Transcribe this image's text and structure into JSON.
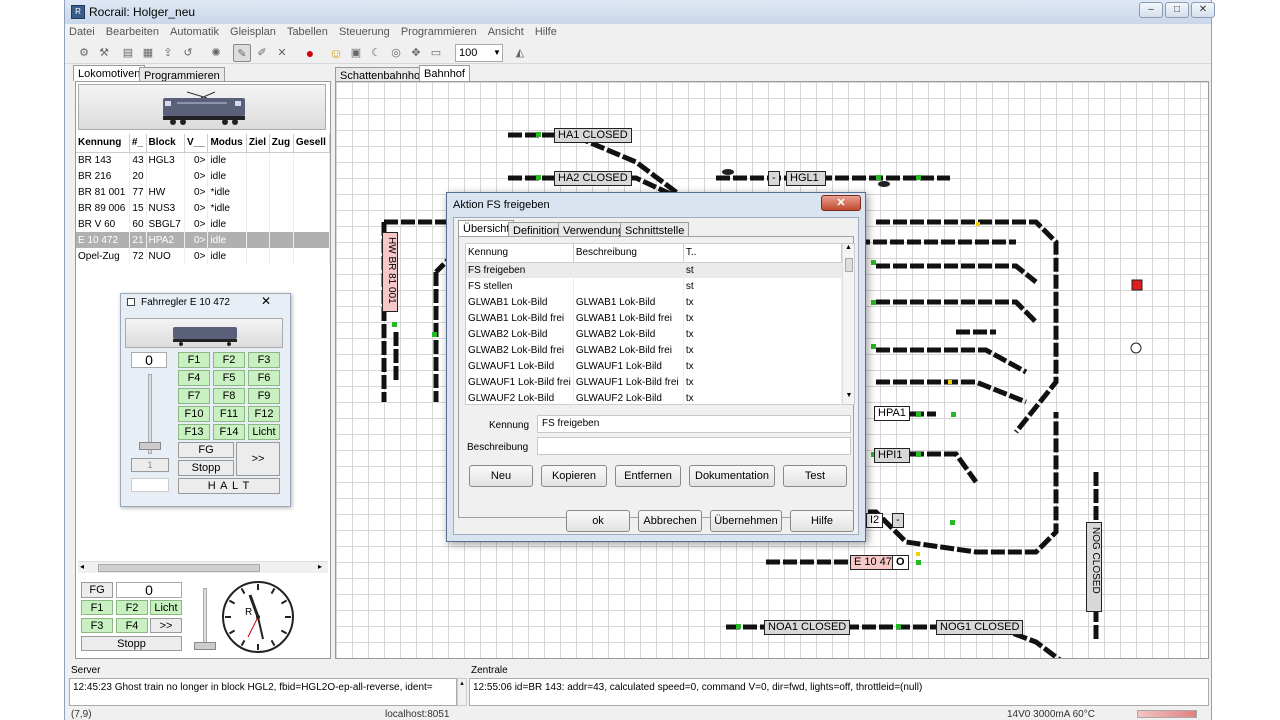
{
  "window": {
    "title": "Rocrail: Holger_neu",
    "app_icon": "rail-icon"
  },
  "menu": [
    "Datei",
    "Bearbeiten",
    "Automatik",
    "Gleisplan",
    "Tabellen",
    "Steuerung",
    "Programmieren",
    "Ansicht",
    "Hilfe"
  ],
  "toolbar": {
    "zoom": "100"
  },
  "left_tabs": [
    "Lokomotiven",
    "Programmieren"
  ],
  "loco_table": {
    "headers": [
      "Kennung",
      "#_",
      "Block",
      "V__",
      "Modus",
      "Ziel",
      "Zug",
      "Gesell"
    ],
    "rows": [
      [
        "BR 143",
        "43",
        "HGL3",
        "0>",
        "idle",
        "",
        "",
        ""
      ],
      [
        "BR 216",
        "20",
        "",
        "0>",
        "idle",
        "",
        "",
        ""
      ],
      [
        "BR 81 001",
        "77",
        "HW",
        "0>",
        "*idle",
        "",
        "",
        ""
      ],
      [
        "BR 89 006",
        "15",
        "NUS3",
        "0>",
        "*idle",
        "",
        "",
        ""
      ],
      [
        "BR V 60",
        "60",
        "SBGL7",
        "0>",
        "idle",
        "",
        "",
        ""
      ],
      [
        "E 10 472",
        "21",
        "HPA2",
        "0>",
        "idle",
        "",
        "",
        ""
      ],
      [
        "Opel-Zug",
        "72",
        "NUO",
        "0>",
        "idle",
        "",
        "",
        ""
      ]
    ],
    "selected_index": 5
  },
  "throttle": {
    "title": "Fahrregler E 10 472",
    "speed": "0",
    "fbuttons": [
      "F1",
      "F2",
      "F3",
      "F4",
      "F5",
      "F6",
      "F7",
      "F8",
      "F9",
      "F10",
      "F11",
      "F12",
      "F13",
      "F14",
      "Licht"
    ],
    "fg": "FG",
    "more": ">>",
    "stop": "Stopp",
    "halt": "H A L T",
    "step": "1"
  },
  "mini_throttle": {
    "fg": "FG",
    "speed": "0",
    "buttons": [
      "F1",
      "F2",
      "Licht",
      "F3",
      "F4",
      ">>"
    ],
    "stop": "Stopp",
    "clock_label": "R"
  },
  "plan_tabs": [
    "Schattenbahnhof",
    "Bahnhof"
  ],
  "plan_blocks": {
    "ha1": "HA1 CLOSED",
    "ha2": "HA2 CLOSED",
    "hgl1": "HGL1",
    "hpa1": "HPA1",
    "hpi1": "HPI1",
    "e10": "E 10 47",
    "i2": "I2",
    "noa1": "NOA1 CLOSED",
    "nog1": "NOG1 CLOSED",
    "nogv": "NOG CLOSED",
    "hw": "HW BR 81 001",
    "dash": "-",
    "o": "O"
  },
  "dialog": {
    "title": "Aktion FS freigeben",
    "tabs": [
      "Übersicht",
      "Definition",
      "Verwendung",
      "Schnittstelle"
    ],
    "headers": [
      "Kennung",
      "Beschreibung",
      "T.."
    ],
    "rows": [
      [
        "FS freigeben",
        "",
        "st"
      ],
      [
        "FS stellen",
        "",
        "st"
      ],
      [
        "GLWAB1 Lok-Bild",
        "GLWAB1 Lok-Bild",
        "tx"
      ],
      [
        "GLWAB1 Lok-Bild frei",
        "GLWAB1 Lok-Bild frei",
        "tx"
      ],
      [
        "GLWAB2 Lok-Bild",
        "GLWAB2 Lok-Bild",
        "tx"
      ],
      [
        "GLWAB2 Lok-Bild frei",
        "GLWAB2 Lok-Bild frei",
        "tx"
      ],
      [
        "GLWAUF1 Lok-Bild",
        "GLWAUF1 Lok-Bild",
        "tx"
      ],
      [
        "GLWAUF1 Lok-Bild frei",
        "GLWAUF1 Lok-Bild frei",
        "tx"
      ],
      [
        "GLWAUF2 Lok-Bild",
        "GLWAUF2 Lok-Bild",
        "tx"
      ]
    ],
    "kennung_label": "Kennung",
    "kennung_value": "FS freigeben",
    "beschreibung_label": "Beschreibung",
    "beschreibung_value": "",
    "buttons": [
      "Neu",
      "Kopieren",
      "Entfernen",
      "Dokumentation",
      "Test"
    ],
    "footer_buttons": [
      "ok",
      "Abbrechen",
      "Übernehmen",
      "Hilfe"
    ]
  },
  "server": {
    "label": "Server",
    "log": "12:45:23 Ghost train no longer in block HGL2, fbid=HGL2O-ep-all-reverse, ident="
  },
  "zentrale": {
    "label": "Zentrale",
    "log": "12:55:06 id=BR 143: addr=43, calculated speed=0, command V=0, dir=fwd, lights=off, throttleid=(null)"
  },
  "status": {
    "left": "(7,9)",
    "host": "localhost:8051",
    "power": "14V0 3000mA 60°C"
  },
  "colors": {
    "accent": "#3a5d8c",
    "green": "#c8f0c0",
    "selection": "#b0b0b0"
  }
}
